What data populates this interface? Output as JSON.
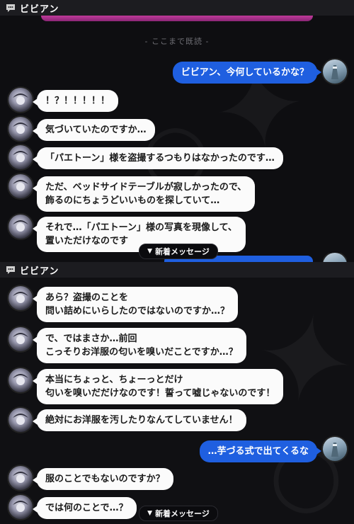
{
  "top": {
    "header_name": "ビビアン",
    "read_marker": "- ここまで既読 -",
    "messages": [
      {
        "text": "ビビアン、今何しているかな？"
      },
      {
        "text": "！？！！！！！"
      },
      {
        "text": "気づいていたのですか…"
      },
      {
        "text": "「パエトーン」様を盗撮するつもりはなかったのです…"
      },
      {
        "text": "ただ、ベッドサイドテーブルが寂しかったので、\n飾るのにちょうどいいものを探していて…"
      },
      {
        "text": "それで…「パエトーン」様の写真を現像して、\n置いただけなのです"
      }
    ],
    "new_messages_label": "新着メッセージ"
  },
  "bottom": {
    "header_name": "ビビアン",
    "messages": [
      {
        "text": "あら？盗撮のことを\n問い詰めにいらしたのではないのですか…？"
      },
      {
        "text": "で、ではまさか…前回\nこっそりお洋服の匂いを嗅いだことですか…？"
      },
      {
        "text": "本当にちょっと、ちょーっとだけ\n匂いを嗅いだだけなのです！誓って嘘じゃないのです！"
      },
      {
        "text": "絶対にお洋服を汚したりなんてしていません！"
      },
      {
        "text": "…芋づる式で出てくるな"
      },
      {
        "text": "服のことでもないのですか？"
      },
      {
        "text": "では何のことで…？"
      }
    ],
    "new_messages_label": "新着メッセージ"
  },
  "colors": {
    "player_bubble": "#1f5fe0",
    "npc_bubble": "#fbfbfb",
    "accent_strip": "#c03a9a"
  }
}
